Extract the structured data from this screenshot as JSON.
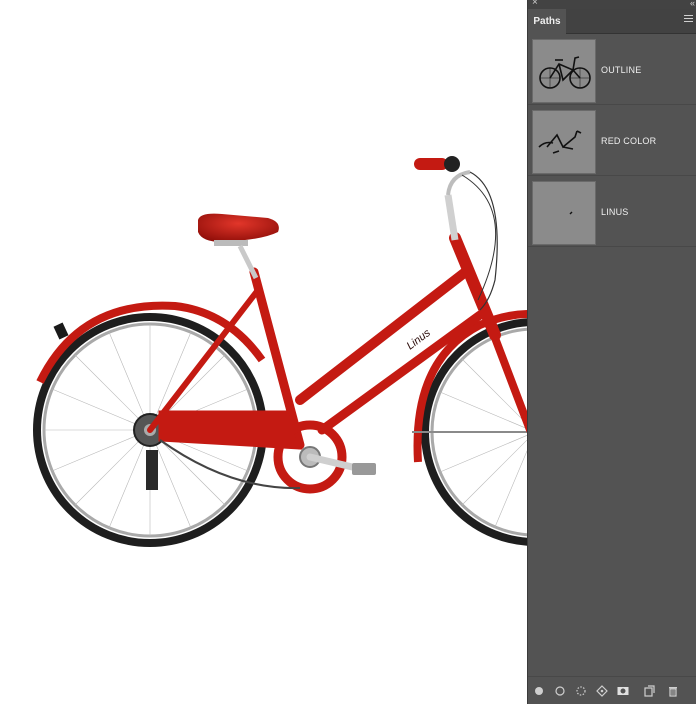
{
  "panel": {
    "tab_label": "Paths",
    "paths": [
      {
        "name": "OUTLINE"
      },
      {
        "name": "RED COLOR"
      },
      {
        "name": "LINUS"
      }
    ]
  },
  "canvas": {
    "frame_brand_text": "Linus"
  },
  "icons": {
    "close": "close-icon",
    "collapse": "collapse-icon",
    "menu": "panel-menu-icon",
    "fill": "fill-path-icon",
    "stroke": "stroke-path-icon",
    "selection": "load-as-selection-icon",
    "workpath": "make-work-path-icon",
    "mask": "add-mask-icon",
    "new": "new-path-icon",
    "delete": "trash-icon"
  },
  "colors": {
    "bike_red": "#c41a12",
    "panel_bg": "#535353",
    "thumb_bg": "#8b8b8b"
  }
}
